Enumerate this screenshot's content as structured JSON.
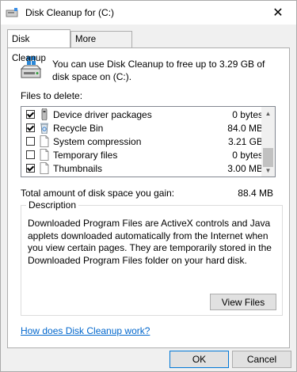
{
  "window": {
    "title": "Disk Cleanup for  (C:)"
  },
  "tabs": [
    {
      "label": "Disk Cleanup",
      "active": true
    },
    {
      "label": "More Options",
      "active": false
    }
  ],
  "intro_text": "You can use Disk Cleanup to free up to 3.29 GB of disk space on  (C:).",
  "files_label": "Files to delete:",
  "files": [
    {
      "name": "Device driver packages",
      "size": "0 bytes",
      "checked": true,
      "icon": "device-driver-icon"
    },
    {
      "name": "Recycle Bin",
      "size": "84.0 MB",
      "checked": true,
      "icon": "recycle-bin-icon"
    },
    {
      "name": "System compression",
      "size": "3.21 GB",
      "checked": false,
      "icon": "file-icon"
    },
    {
      "name": "Temporary files",
      "size": "0 bytes",
      "checked": false,
      "icon": "file-icon"
    },
    {
      "name": "Thumbnails",
      "size": "3.00 MB",
      "checked": true,
      "icon": "file-icon"
    }
  ],
  "total": {
    "label": "Total amount of disk space you gain:",
    "value": "88.4 MB"
  },
  "description": {
    "legend": "Description",
    "text": "Downloaded Program Files are ActiveX controls and Java applets downloaded automatically from the Internet when you view certain pages. They are temporarily stored in the Downloaded Program Files folder on your hard disk.",
    "button": "View Files"
  },
  "help_link": "How does Disk Cleanup work?",
  "buttons": {
    "ok": "OK",
    "cancel": "Cancel"
  }
}
